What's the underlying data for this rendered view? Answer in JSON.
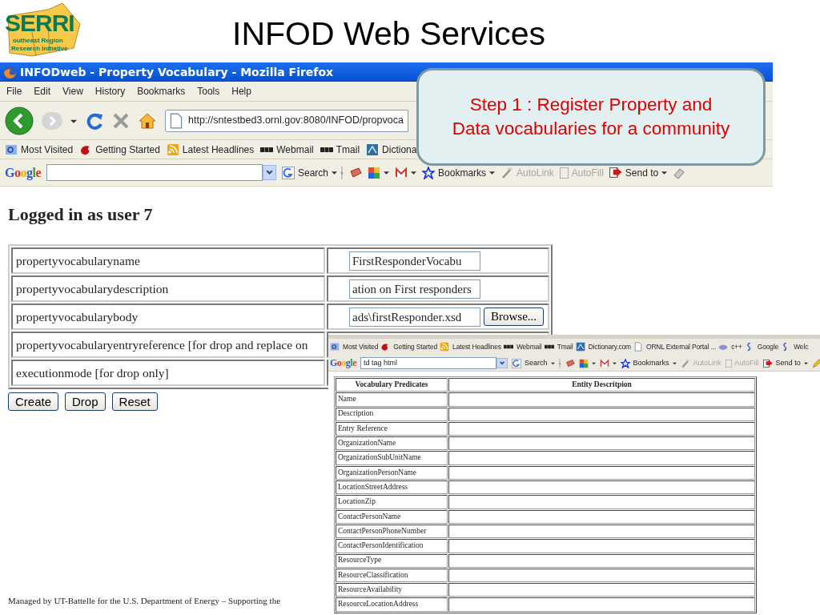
{
  "slide": {
    "title": "INFOD Web Services",
    "logo": {
      "wordmark": "SERRI",
      "line1": "outheast Region",
      "line2": "Research Initiative"
    },
    "footer": "Managed by UT-Battelle for the U.S. Department of Energy – Supporting the"
  },
  "browser": {
    "window_title": "INFODweb - Property Vocabulary - Mozilla Firefox",
    "menu": [
      "File",
      "Edit",
      "View",
      "History",
      "Bookmarks",
      "Tools",
      "Help"
    ],
    "address": "http://sntestbed3.ornl.gov:8080/INFOD/propvoca",
    "bookmarks": [
      {
        "kind": "search",
        "label": "Most Visited"
      },
      {
        "kind": "firefox",
        "label": "Getting Started"
      },
      {
        "kind": "rss",
        "label": "Latest Headlines"
      },
      {
        "kind": "bbc",
        "label": "Webmail"
      },
      {
        "kind": "bbc",
        "label": "Tmail"
      },
      {
        "kind": "dictionary",
        "label": "Dictiona"
      }
    ],
    "google_toolbar": {
      "logo": "Google",
      "items": [
        {
          "kind": "search",
          "label": "Search",
          "dropdown": true,
          "disabled": false
        },
        {
          "kind": "news",
          "dropdown": false,
          "disabled": false
        },
        {
          "kind": "puzzle",
          "dropdown": true,
          "disabled": false
        },
        {
          "kind": "gmail",
          "dropdown": true,
          "disabled": false
        },
        {
          "kind": "bookmarks",
          "label": "Bookmarks",
          "dropdown": true,
          "disabled": false
        },
        {
          "kind": "autolink",
          "label": "AutoLink",
          "dropdown": false,
          "disabled": true
        },
        {
          "kind": "autofill",
          "label": "AutoFill",
          "dropdown": false,
          "disabled": true
        },
        {
          "kind": "sendto",
          "label": "Send to",
          "dropdown": true,
          "disabled": false
        },
        {
          "kind": "eraser",
          "dropdown": false,
          "disabled": false
        }
      ]
    }
  },
  "page": {
    "heading": "Logged in as user 7",
    "form_rows": [
      {
        "label": "propertyvocabularyname",
        "value": "FirstResponderVocabu"
      },
      {
        "label": "propertyvocabularydescription",
        "value": "ation on First responders"
      },
      {
        "label": "propertyvocabularybody",
        "value": "ads\\firstResponder.xsd",
        "browse": "Browse..."
      },
      {
        "label": "propertyvocabularyentryreference [for drop and replace on"
      },
      {
        "label": "executionmode [for drop only]"
      }
    ],
    "buttons": [
      "Create",
      "Drop",
      "Reset"
    ]
  },
  "callout": {
    "lines": [
      "Step 1 :  Register Property and",
      "Data vocabularies for a community"
    ]
  },
  "inset": {
    "bookmarks": [
      {
        "kind": "search",
        "label": "Most Visited"
      },
      {
        "kind": "firefox",
        "label": "Getting Started"
      },
      {
        "kind": "rss",
        "label": "Latest Headlines"
      },
      {
        "kind": "bbc",
        "label": "Webmail"
      },
      {
        "kind": "bbc",
        "label": "Tmail"
      },
      {
        "kind": "dictionary",
        "label": "Dictionary.com"
      },
      {
        "kind": "page",
        "label": "ORNL External Portal ..."
      },
      {
        "kind": "cpp",
        "label": "c++"
      },
      {
        "kind": "google",
        "label": "Google"
      },
      {
        "kind": "google",
        "label": "Welc"
      }
    ],
    "google_toolbar": {
      "logo": "Google",
      "search_value": "td tag html",
      "items": [
        {
          "kind": "search",
          "label": "Search",
          "dropdown": true,
          "disabled": false
        },
        {
          "kind": "news",
          "dropdown": false,
          "disabled": false
        },
        {
          "kind": "puzzle",
          "dropdown": true,
          "disabled": false
        },
        {
          "kind": "gmail",
          "dropdown": true,
          "disabled": false
        },
        {
          "kind": "bookmarks",
          "label": "Bookmarks",
          "dropdown": true,
          "disabled": false
        },
        {
          "kind": "autolink",
          "label": "AutoLink",
          "dropdown": false,
          "disabled": true
        },
        {
          "kind": "autofill",
          "label": "AutoFill",
          "dropdown": false,
          "disabled": true
        },
        {
          "kind": "sendto",
          "label": "Send to",
          "dropdown": true,
          "disabled": false
        },
        {
          "kind": "pencil",
          "dropdown": false,
          "disabled": false
        }
      ]
    },
    "table": {
      "columns": [
        "Vocabulary Predicates",
        "Entity Descritpion"
      ],
      "rows": [
        "Name",
        "Description",
        "Entry Reference",
        "OrganizationName",
        "OrganizationSubUnitName",
        "OrganizationPersonName",
        "LocationStreetAddress",
        "LocationZip",
        "ContactPersonName",
        "ContactPersonPhoneNumber",
        "ContactPersonIdentification",
        "ResourceType",
        "ResourceClassification",
        "ResourceAvailability",
        "ResourceLocationAddress"
      ]
    }
  }
}
